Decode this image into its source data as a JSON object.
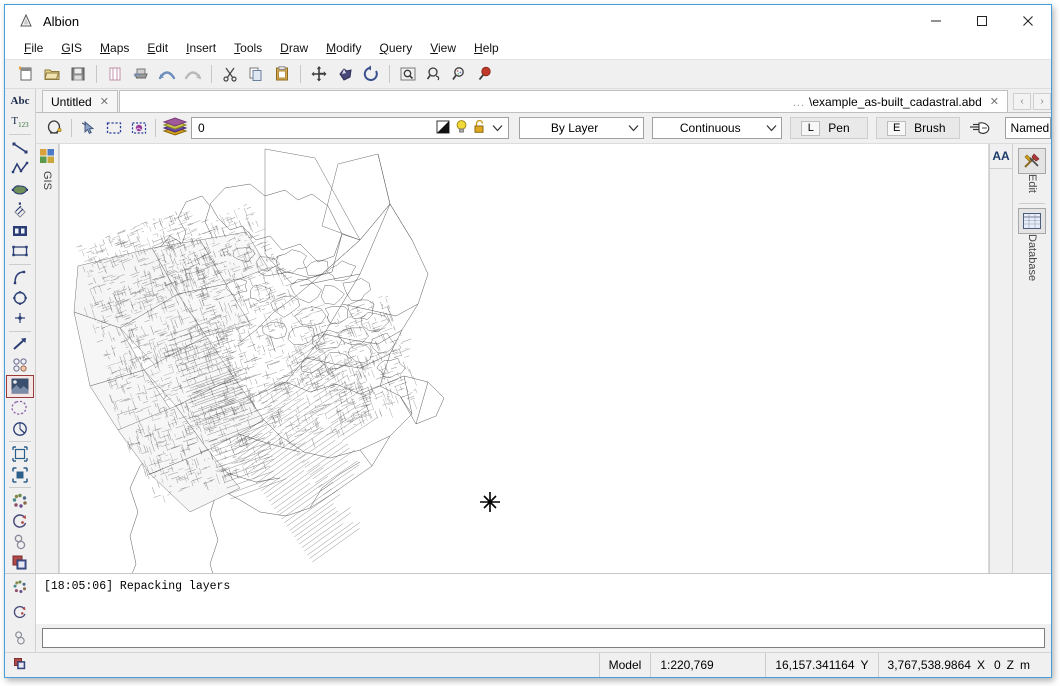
{
  "window": {
    "title": "Albion",
    "app_icon": "albion-icon",
    "controls": {
      "minimize": "minimize-icon",
      "maximize": "maximize-icon",
      "close": "close-icon"
    }
  },
  "menu": {
    "items": [
      {
        "label": "File",
        "accel": "F"
      },
      {
        "label": "GIS",
        "accel": "G"
      },
      {
        "label": "Maps",
        "accel": "M"
      },
      {
        "label": "Edit",
        "accel": "E"
      },
      {
        "label": "Insert",
        "accel": "I"
      },
      {
        "label": "Tools",
        "accel": "T"
      },
      {
        "label": "Draw",
        "accel": "D"
      },
      {
        "label": "Modify",
        "accel": "M"
      },
      {
        "label": "Query",
        "accel": "Q"
      },
      {
        "label": "View",
        "accel": "V"
      },
      {
        "label": "Help",
        "accel": "H"
      }
    ]
  },
  "toolbar": {
    "buttons": [
      {
        "name": "new-document-icon"
      },
      {
        "name": "open-folder-icon"
      },
      {
        "name": "save-icon"
      },
      {
        "sep": true
      },
      {
        "name": "page-setup-icon"
      },
      {
        "name": "print-icon"
      },
      {
        "name": "undo-icon"
      },
      {
        "name": "redo-icon"
      },
      {
        "sep": true
      },
      {
        "name": "cut-scissors-icon"
      },
      {
        "name": "copy-icon"
      },
      {
        "name": "paste-clipboard-icon"
      },
      {
        "sep": true
      },
      {
        "name": "pan-move-icon"
      },
      {
        "name": "zoom-extents-icon"
      },
      {
        "name": "refresh-redraw-icon"
      },
      {
        "sep": true
      },
      {
        "name": "zoom-window-icon"
      },
      {
        "name": "zoom-previous-icon"
      },
      {
        "name": "zoom-dynamic-icon"
      },
      {
        "name": "zoom-in-icon"
      }
    ]
  },
  "tabs": {
    "items": [
      {
        "label": "Untitled",
        "active": false,
        "closable": true
      },
      {
        "label": "\\example_as-built_cadastral.abd",
        "prefix": "...",
        "active": true,
        "closable": true
      }
    ],
    "nav_prev": "‹",
    "nav_next": "›"
  },
  "properties": {
    "tools": [
      {
        "name": "layer-manager-icon"
      },
      {
        "name": "select-arrow-icon"
      },
      {
        "name": "select-window-icon"
      },
      {
        "name": "select-image-icon"
      },
      {
        "name": "layers-stack-icon"
      }
    ],
    "layer_value": "0",
    "layer_icons": [
      {
        "name": "layer-color-swatch-icon"
      },
      {
        "name": "layer-visible-bulb-icon"
      },
      {
        "name": "layer-unlocked-icon"
      }
    ],
    "color_value": "By Layer",
    "linetype_value": "Continuous",
    "pen": {
      "key": "L",
      "label": "Pen"
    },
    "brush": {
      "key": "E",
      "label": "Brush"
    },
    "pick_icon": "pick-pointer-icon",
    "named_value": "Named"
  },
  "left_tools": [
    {
      "name": "text-abc-icon",
      "glyph": "Abc"
    },
    {
      "name": "text-subscript-icon",
      "glyph": "T123"
    },
    {
      "sep": true
    },
    {
      "name": "line-tool-icon"
    },
    {
      "name": "polyline-tool-icon"
    },
    {
      "name": "polygon-fill-tool-icon"
    },
    {
      "name": "hatch-tool-icon"
    },
    {
      "name": "insert-block-icon"
    },
    {
      "name": "rectangle-tool-icon"
    },
    {
      "sep": true
    },
    {
      "name": "arc-tool-icon"
    },
    {
      "name": "circle-tool-icon"
    },
    {
      "name": "point-tool-icon"
    },
    {
      "sep": true
    },
    {
      "name": "vector-arrow-icon"
    },
    {
      "name": "multi-point-icon"
    },
    {
      "name": "raster-image-icon",
      "selected": true
    },
    {
      "name": "selection-marquee-icon"
    },
    {
      "name": "measure-angle-icon"
    },
    {
      "sep": true
    },
    {
      "name": "scale-object-icon"
    },
    {
      "name": "transform-object-icon"
    },
    {
      "sep": true
    },
    {
      "name": "cluster-points-icon"
    },
    {
      "name": "rotate-object-icon"
    },
    {
      "name": "topology-chain-icon"
    },
    {
      "name": "overlap-layers-icon"
    }
  ],
  "gis_panel": {
    "icon": "gis-layers-icon",
    "label": "GIS"
  },
  "right_panel": {
    "aa_button": "AA",
    "sections": [
      {
        "icon": "edit-tools-icon",
        "label": "Edit",
        "selected": true
      },
      {
        "icon": "database-table-icon",
        "label": "Database",
        "selected": false
      }
    ]
  },
  "console": {
    "icons": [
      {
        "name": "cluster-points-icon"
      },
      {
        "name": "rotate-object-icon"
      },
      {
        "name": "topology-chain-icon"
      },
      {
        "name": "overlap-layers-icon"
      }
    ],
    "lines": [
      "[18:05:06] Repacking layers"
    ],
    "command_input_value": "",
    "command_input_placeholder": ""
  },
  "statusbar": {
    "model_label": "Model",
    "scale": "1:220,769",
    "coord_y_value": "16,157.341164",
    "coord_y_label": "Y",
    "coord_x_value": "3,767,538.9864",
    "coord_x_label": "X",
    "coord_z_value": "0",
    "coord_z_label": "Z",
    "units": "m"
  },
  "colors": {
    "accent_border": "#4a9ddc",
    "chrome": "#f0f0f0",
    "canvas": "#ffffff",
    "map_stroke": "#5a5a5a"
  },
  "map": {
    "cursor_marker": "snap-crosshair-marker",
    "description": "as-built cadastral parcel map"
  }
}
